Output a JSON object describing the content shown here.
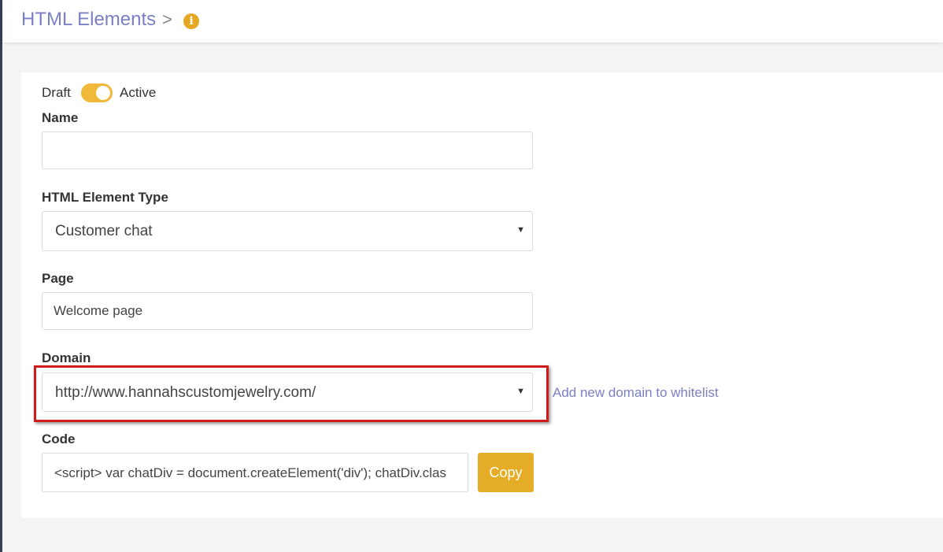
{
  "header": {
    "title": "HTML Elements",
    "separator": ">",
    "info_icon_glyph": "i"
  },
  "status": {
    "off_label": "Draft",
    "on_label": "Active",
    "is_active": true
  },
  "form": {
    "name": {
      "label": "Name",
      "value": "",
      "placeholder": ""
    },
    "element_type": {
      "label": "HTML Element Type",
      "selected": "Customer chat"
    },
    "page": {
      "label": "Page",
      "value": "Welcome page"
    },
    "domain": {
      "label": "Domain",
      "selected": "http://www.hannahscustomjewelry.com/",
      "add_link": "Add new domain to whitelist"
    },
    "code": {
      "label": "Code",
      "value": "<script> var chatDiv = document.createElement('div'); chatDiv.clas",
      "copy_label": "Copy"
    }
  },
  "colors": {
    "accent": "#e5ac27",
    "link": "#7b80c6",
    "highlight": "#d21a1a"
  }
}
